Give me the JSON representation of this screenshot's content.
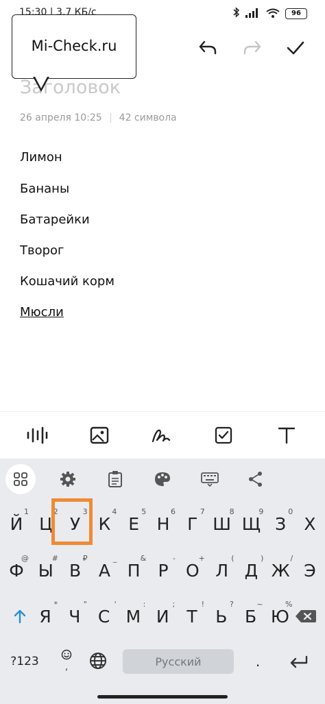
{
  "status": {
    "time": "15:30 | 3,7 КБ/с",
    "battery": "96"
  },
  "watermark": {
    "text": "Mi-Check.ru"
  },
  "note": {
    "title_placeholder": "Заголовок",
    "date": "26 апреля  10:25",
    "char_count": "42 символа",
    "lines": [
      "Лимон",
      "Бананы",
      "Батарейки",
      "Творог",
      "Кошачий корм",
      "Мюсли"
    ]
  },
  "keyboard": {
    "row1": [
      {
        "k": "Й",
        "s": "1"
      },
      {
        "k": "Ц",
        "s": "2"
      },
      {
        "k": "У",
        "s": "3"
      },
      {
        "k": "К",
        "s": "4"
      },
      {
        "k": "Е",
        "s": "5"
      },
      {
        "k": "Н",
        "s": "6"
      },
      {
        "k": "Г",
        "s": "7"
      },
      {
        "k": "Ш",
        "s": "8"
      },
      {
        "k": "Щ",
        "s": "9"
      },
      {
        "k": "З",
        "s": "0"
      },
      {
        "k": "Х",
        "s": ""
      }
    ],
    "row2": [
      {
        "k": "Ф",
        "s": "@"
      },
      {
        "k": "Ы",
        "s": "#"
      },
      {
        "k": "В",
        "s": "₽"
      },
      {
        "k": "А",
        "s": "_"
      },
      {
        "k": "П",
        "s": "&"
      },
      {
        "k": "Р",
        "s": "-"
      },
      {
        "k": "О",
        "s": "+"
      },
      {
        "k": "Л",
        "s": "("
      },
      {
        "k": "Д",
        "s": ")"
      },
      {
        "k": "Ж",
        "s": "/"
      },
      {
        "k": "Э",
        "s": ""
      }
    ],
    "row3": [
      {
        "k": "Я",
        "s": "*"
      },
      {
        "k": "Ч",
        "s": "\""
      },
      {
        "k": "С",
        "s": "'"
      },
      {
        "k": "М",
        "s": ":"
      },
      {
        "k": "И",
        "s": ";"
      },
      {
        "k": "Т",
        "s": "!"
      },
      {
        "k": "Ь",
        "s": "?"
      },
      {
        "k": "Б",
        "s": "~"
      },
      {
        "k": "Ю",
        "s": "%"
      }
    ],
    "mode_key": "?123",
    "space_label": "Русский",
    "period_key": "."
  },
  "colors": {
    "highlight": "#f08a34",
    "shift": "#2a8cd1"
  }
}
